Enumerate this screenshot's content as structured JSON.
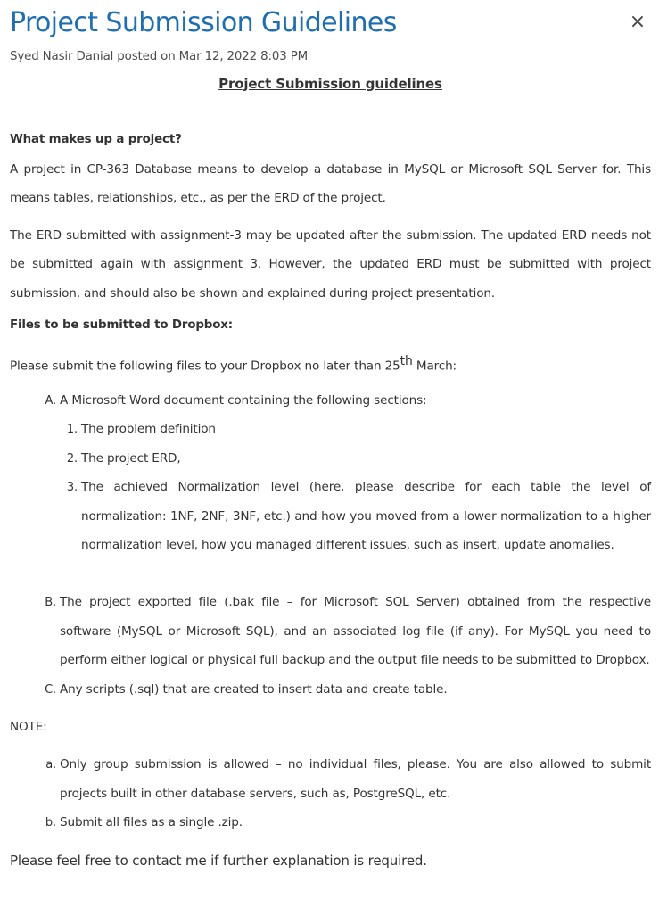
{
  "dialog": {
    "title": "Project Submission Guidelines",
    "close_label": "×",
    "meta": "Syed Nasir Danial posted on Mar 12, 2022 8:03 PM"
  },
  "body": {
    "heading": "Project Submission guidelines",
    "section1_title": "What makes up a project?",
    "para1": "A project in CP-363 Database means to develop a database in MySQL or Microsoft SQL Server for. This means tables, relationships, etc., as per the ERD of the project.",
    "para2": "The ERD submitted with assignment-3 may be updated after the submission. The updated ERD needs not be submitted again with assignment 3. However, the updated ERD must be submitted with project submission, and should also be shown and explained during project presentation.",
    "section2_title": "Files to be submitted to Dropbox:",
    "intro_before": "Please submit the following files to your Dropbox no later than 25",
    "intro_sup": "th",
    "intro_after": " March:",
    "itemA": "A Microsoft Word document containing the following sections:",
    "itemA_sub": [
      "The problem definition",
      "The project ERD,",
      "The achieved Normalization level (here, please describe for each table the level of normalization: 1NF, 2NF, 3NF, etc.) and how you moved from a lower normalization to a higher normalization level, how you managed different issues, such as insert, update anomalies."
    ],
    "itemB": "The project exported file (.bak file – for Microsoft SQL Server) obtained from the respective software (MySQL or Microsoft SQL), and an associated log file (if any). For MySQL you need to perform either logical or physical full backup and the output file needs to be submitted to Dropbox.",
    "itemC": "Any scripts (.sql) that are created to insert data and create table.",
    "note_label": "NOTE:",
    "notes": [
      "Only group submission is allowed – no individual files, please. You are also allowed to submit projects built in other database servers, such as, PostgreSQL, etc.",
      "Submit all files as a single .zip."
    ],
    "footer": "Please feel free to contact me if further explanation is required."
  },
  "colors": {
    "title": "#1f6fb0",
    "text": "#333333"
  }
}
